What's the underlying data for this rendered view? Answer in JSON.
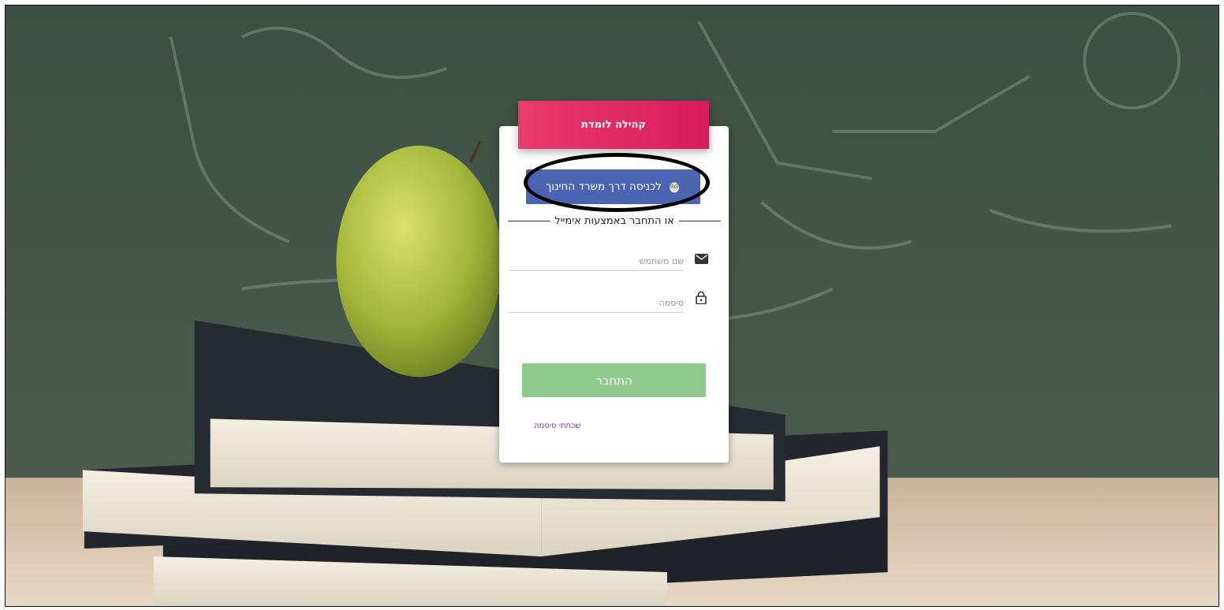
{
  "header": {
    "title": "קהילה לומדת"
  },
  "sso": {
    "label": "לכניסה דרך משרד החינוך"
  },
  "divider": {
    "text": "או התחבר באמצעות אימייל"
  },
  "form": {
    "username_placeholder": "שם משתמש",
    "password_placeholder": "סיסמה",
    "username_value": "",
    "password_value": ""
  },
  "actions": {
    "login_label": "התחבר",
    "forgot_label": "שכחתי סיסמה"
  },
  "colors": {
    "header_accent": "#e02a66",
    "sso_button": "#4a64b1",
    "login_button": "#8fca8d",
    "forgot_link": "#7a3aa8"
  },
  "icons": [
    "mail-icon",
    "lock-icon",
    "owl-icon"
  ]
}
